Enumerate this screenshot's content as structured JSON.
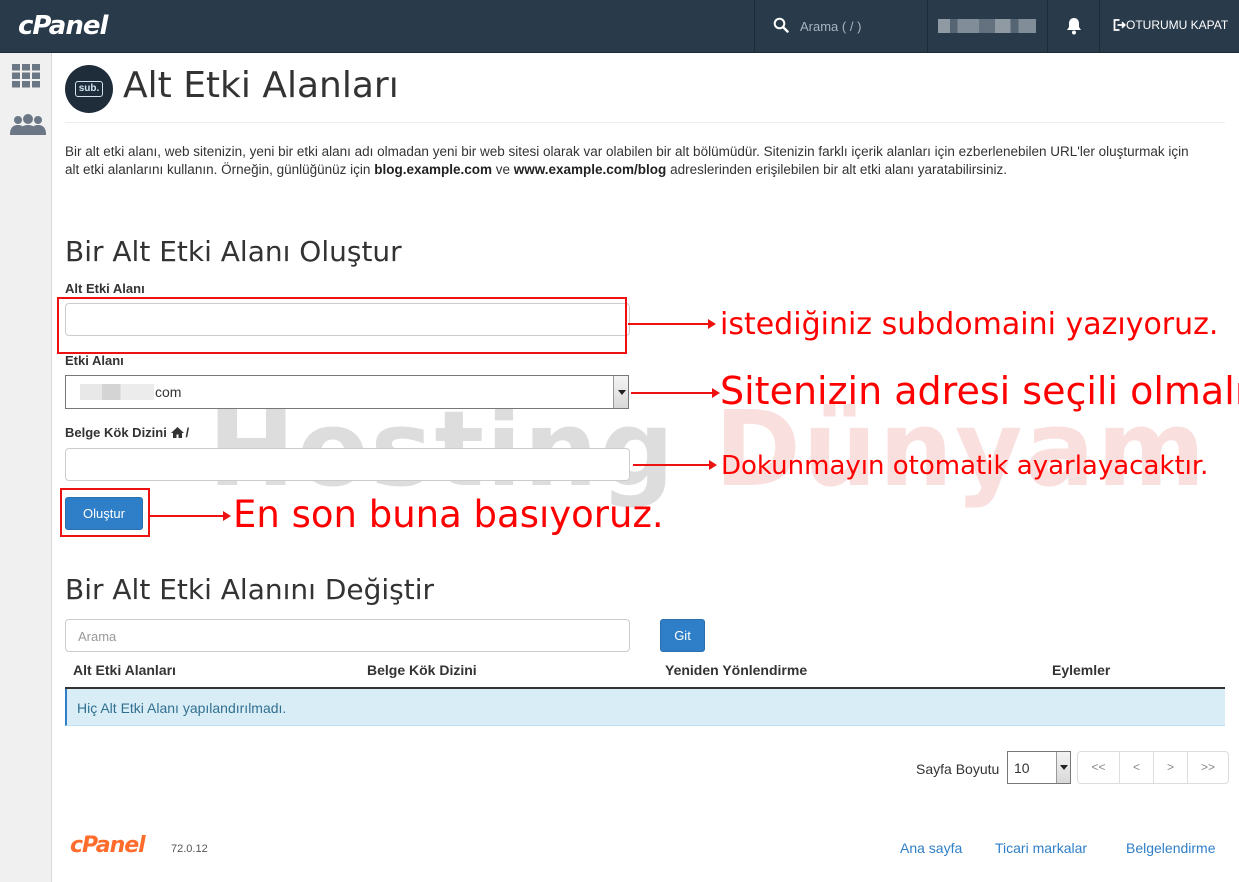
{
  "topbar": {
    "logo": "cPanel",
    "search_placeholder": "Arama ( / )",
    "logout_label": "OTURUMU KAPAT"
  },
  "page": {
    "icon_text": "sub.",
    "title": "Alt Etki Alanları",
    "description": {
      "part1": "Bir alt etki alanı, web sitenizin, yeni bir etki alanı adı olmadan yeni bir web sitesi olarak var olabilen bir alt bölümüdür. Sitenizin farklı içerik alanları için ezberlenebilen URL'ler oluşturmak için alt etki alanlarını kullanın. Örneğin, günlüğünüz için ",
      "bold1": "blog.example.com",
      "part2": " ve ",
      "bold2": "www.example.com/blog",
      "part3": " adreslerinden erişilebilen bir alt etki alanı yaratabilirsiniz."
    }
  },
  "create": {
    "heading": "Bir Alt Etki Alanı Oluştur",
    "subdomain_label": "Alt Etki Alanı",
    "subdomain_value": "",
    "domain_label": "Etki Alanı",
    "domain_value": "com",
    "docroot_label": "Belge Kök Dizini",
    "docroot_suffix": "/",
    "docroot_value": "",
    "submit_label": "Oluştur"
  },
  "annotations": {
    "subdomain": "istediğiniz subdomaini yazıyoruz.",
    "domain": "Sitenizin adresi seçili olmalı",
    "docroot": "Dokunmayın otomatik ayarlayacaktır.",
    "submit": "En son buna basıyoruz.",
    "color": "#ff0000"
  },
  "watermark": {
    "part1": "Hosting",
    "part2": "Dünyam"
  },
  "modify": {
    "heading": "Bir Alt Etki Alanını Değiştir",
    "search_placeholder": "Arama",
    "go_label": "Git",
    "columns": [
      "Alt Etki Alanları",
      "Belge Kök Dizini",
      "Yeniden Yönlendirme",
      "Eylemler"
    ],
    "empty_message": "Hiç Alt Etki Alanı yapılandırılmadı.",
    "page_size_label": "Sayfa Boyutu",
    "page_size_value": "10",
    "pager": [
      "<<",
      "<",
      ">",
      ">>"
    ]
  },
  "footer": {
    "logo": "cPanel",
    "version": "72.0.12",
    "links": [
      "Ana sayfa",
      "Ticari markalar",
      "Belgelendirme"
    ]
  },
  "colors": {
    "topbar": "#293a4a",
    "primary_button": "#2f7fc8",
    "info_row": "#d9edf7",
    "footer_logo": "#ff6c2c"
  }
}
